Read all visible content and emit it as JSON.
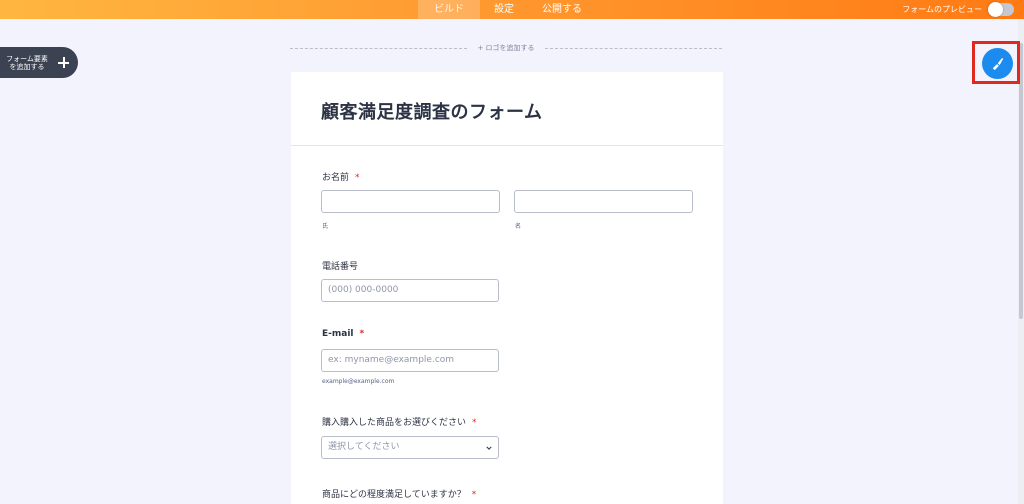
{
  "topbar": {
    "tabs": [
      {
        "label": "ビルド",
        "active": true
      },
      {
        "label": "設定",
        "active": false
      },
      {
        "label": "公開する",
        "active": false
      }
    ],
    "preview_label": "フォームのプレビュー"
  },
  "sidebar": {
    "add_element_label": "フォーム要素を追加する"
  },
  "logo": {
    "add_logo_label": "+ ロゴを追加する"
  },
  "form": {
    "title": "顧客満足度調査のフォーム",
    "name_field": {
      "label": "お名前",
      "required_mark": "*",
      "first_sublabel": "氏",
      "last_sublabel": "名"
    },
    "phone_field": {
      "label": "電話番号",
      "placeholder": "(000) 000-0000"
    },
    "email_field": {
      "label": "E-mail",
      "required_mark": "*",
      "placeholder": "ex: myname@example.com",
      "sublabel": "example@example.com"
    },
    "product_field": {
      "label": "購入購入した商品をお選びください",
      "required_mark": "*",
      "selected": "選択してください"
    },
    "satisfaction_field": {
      "label": "商品にどの程度満足していますか？",
      "required_mark": "*"
    }
  },
  "icons": {
    "paint": "paint-brush-icon",
    "add": "plus-icon",
    "select": "chevron-down-icon"
  },
  "colors": {
    "topbar_start": "#ffb640",
    "topbar_end": "#ff7a14",
    "accent_blue": "#1b8bf0",
    "highlight_red": "#e0281e",
    "canvas_bg": "#f3f3fe"
  }
}
